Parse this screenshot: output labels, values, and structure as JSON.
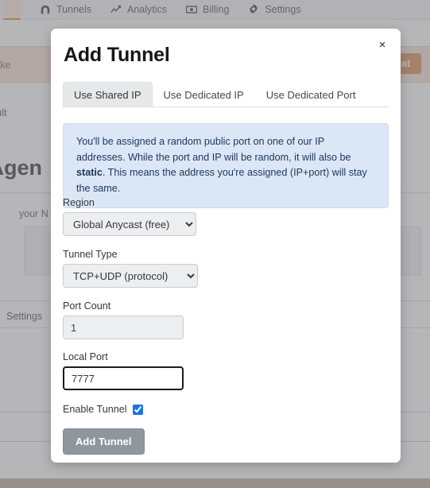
{
  "background": {
    "navbar": {
      "items": [
        {
          "label": "Tunnels",
          "icon": "tunnel-icon"
        },
        {
          "label": "Analytics",
          "icon": "chart-line-icon"
        },
        {
          "label": "Billing",
          "icon": "money-icon"
        },
        {
          "label": "Settings",
          "icon": "gear-icon"
        }
      ]
    },
    "alert_text": "nnel to make",
    "create_button": "Creat",
    "default_text": "efault",
    "heading": ": Agen",
    "sub_text": "your N",
    "settings_text": "Settings",
    "colors": {
      "alert_bg": "#f6e3d4",
      "alert_text": "#9b5a28",
      "create_button_bg": "#dc8c4e",
      "footer_strip": "#bda99b"
    }
  },
  "modal": {
    "title": "Add Tunnel",
    "close_label": "×",
    "tabs": [
      {
        "label": "Use Shared IP",
        "active": true
      },
      {
        "label": "Use Dedicated IP",
        "active": false
      },
      {
        "label": "Use Dedicated Port",
        "active": false
      }
    ],
    "info": {
      "text_part_1": "You'll be assigned a random public port on one of our IP addresses. While the port and IP will be random, it will also be ",
      "text_bold": "static",
      "text_part_2": ". This means the address you're assigned (IP+port) will stay the same.",
      "bg_color": "#dbe7f6",
      "text_color": "#1d3557"
    },
    "fields": {
      "region": {
        "label": "Region",
        "value": "Global Anycast (free)",
        "options": [
          "Global Anycast (free)"
        ]
      },
      "tunnel_type": {
        "label": "Tunnel Type",
        "value": "TCP+UDP (protocol)",
        "options": [
          "TCP+UDP (protocol)"
        ]
      },
      "port_count": {
        "label": "Port Count",
        "value": "1",
        "placeholder": "1"
      },
      "local_port": {
        "label": "Local Port",
        "value": "7777",
        "placeholder": "",
        "focused": true
      },
      "enable_tunnel": {
        "label": "Enable Tunnel",
        "checked": true
      }
    },
    "submit_label": "Add Tunnel",
    "submit_color": "#8f969d"
  }
}
